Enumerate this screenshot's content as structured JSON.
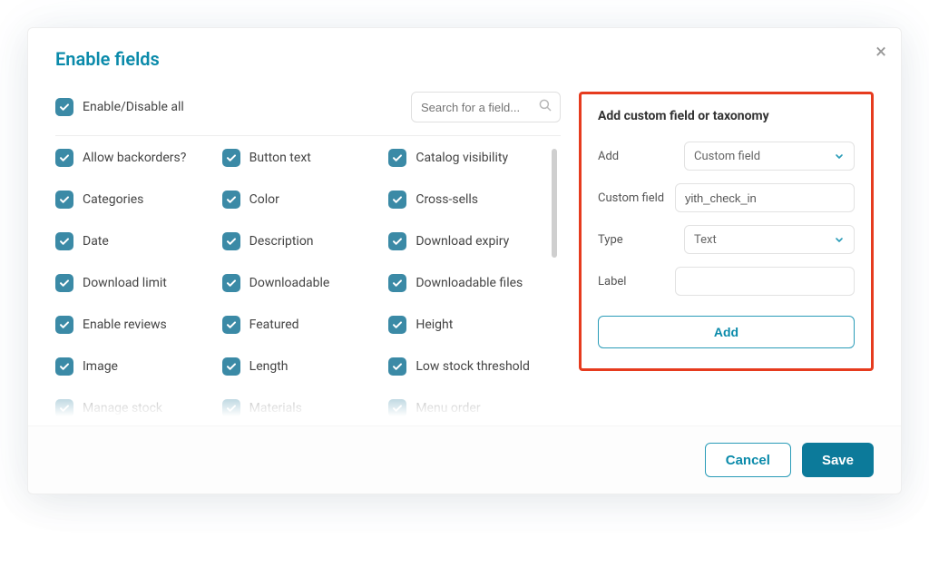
{
  "modal": {
    "title": "Enable fields",
    "close_symbol": "×"
  },
  "toolbar": {
    "toggle_all_label": "Enable/Disable all",
    "search_placeholder": "Search for a field..."
  },
  "fields": [
    "Allow backorders?",
    "Button text",
    "Catalog visibility",
    "Categories",
    "Color",
    "Cross-sells",
    "Date",
    "Description",
    "Download expiry",
    "Download limit",
    "Downloadable",
    "Downloadable files",
    "Enable reviews",
    "Featured",
    "Height",
    "Image",
    "Length",
    "Low stock threshold",
    "Manage stock",
    "Materials",
    "Menu order"
  ],
  "custom_panel": {
    "title": "Add custom field or taxonomy",
    "rows": {
      "add_label": "Add",
      "add_value": "Custom field",
      "cf_label": "Custom field",
      "cf_value": "yith_check_in",
      "type_label": "Type",
      "type_value": "Text",
      "label_label": "Label",
      "label_value": ""
    },
    "add_button": "Add"
  },
  "footer": {
    "cancel": "Cancel",
    "save": "Save"
  }
}
